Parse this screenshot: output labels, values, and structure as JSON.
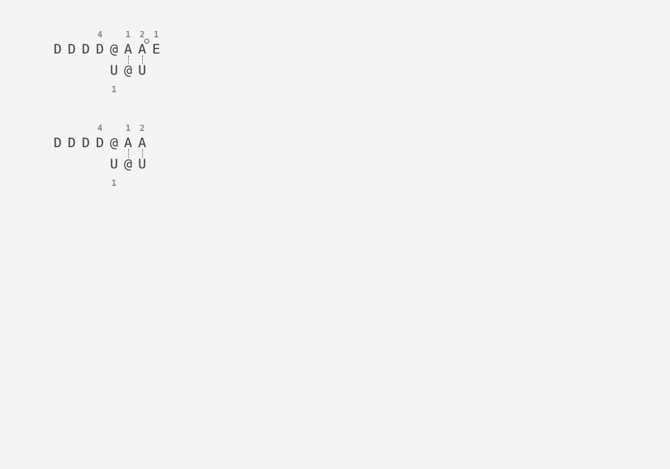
{
  "alignments": [
    {
      "top_numbers": {
        "3": "4",
        "5": "1",
        "6": "2",
        "7": "1"
      },
      "top_row": [
        "D",
        "D",
        "D",
        "D",
        "@",
        "A",
        "A",
        "E"
      ],
      "bottom_row": {
        "4": "U",
        "5": "@",
        "6": "U"
      },
      "bottom_numbers": {
        "4": "1"
      },
      "links": [
        5,
        6
      ],
      "marker_columns": [
        6
      ]
    },
    {
      "top_numbers": {
        "3": "4",
        "5": "1",
        "6": "2"
      },
      "top_row": [
        "D",
        "D",
        "D",
        "D",
        "@",
        "A",
        "A"
      ],
      "bottom_row": {
        "4": "U",
        "5": "@",
        "6": "U"
      },
      "bottom_numbers": {
        "4": "1"
      },
      "links": [
        5,
        6
      ],
      "marker_columns": []
    }
  ]
}
